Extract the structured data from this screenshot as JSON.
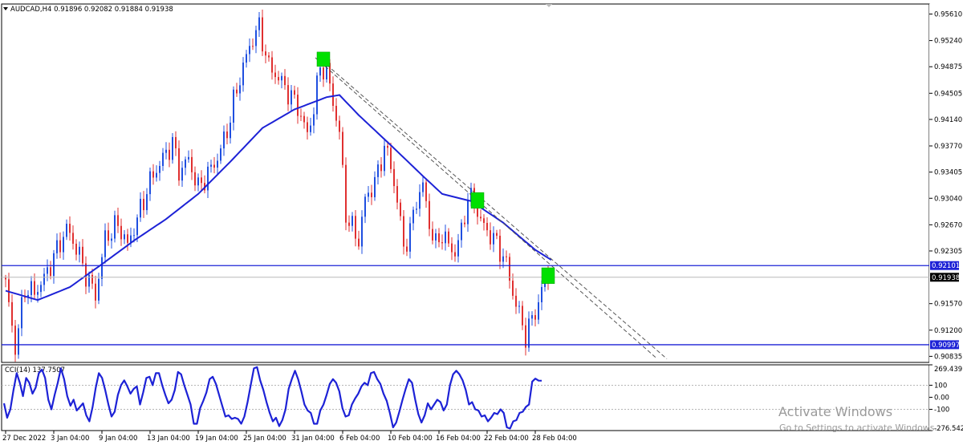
{
  "header": {
    "symbol_line": "AUDCAD,H4  0.91896 0.92082 0.91884 0.91938"
  },
  "watermark": {
    "title": "Activate Windows",
    "subtitle": "Go to Settings to activate Windows."
  },
  "colors": {
    "bull": "#1f4fe0",
    "bear": "#e03030",
    "ma": "#1d22d6",
    "hline": "#1d22d6",
    "box": "#00e000",
    "cci": "#1d22d6",
    "price_tag_bg": "#1d22d6",
    "current_tag_bg": "#000000"
  },
  "chart_data": [
    {
      "type": "candlestick",
      "title": "AUDCAD,H4",
      "ylim": [
        0.9075,
        0.9575
      ],
      "yticks": [
        "0.95610",
        "0.95240",
        "0.94875",
        "0.94505",
        "0.94140",
        "0.93770",
        "0.93405",
        "0.93040",
        "0.92670",
        "0.92305",
        "0.91570",
        "0.91200",
        "0.90835"
      ],
      "xticks": [
        "27 Dec 2022",
        "3 Jan 04:00",
        "9 Jan 04:00",
        "13 Jan 04:00",
        "19 Jan 04:00",
        "25 Jan 04:00",
        "31 Jan 04:00",
        "6 Feb 04:00",
        "10 Feb 04:00",
        "16 Feb 04:00",
        "22 Feb 04:00",
        "28 Feb 04:00"
      ],
      "close_anchors": [
        [
          0,
          0.9185
        ],
        [
          3,
          0.9095
        ],
        [
          6,
          0.9178
        ],
        [
          9,
          0.9172
        ],
        [
          12,
          0.9192
        ],
        [
          15,
          0.9222
        ],
        [
          19,
          0.9262
        ],
        [
          22,
          0.9235
        ],
        [
          25,
          0.9198
        ],
        [
          28,
          0.9168
        ],
        [
          31,
          0.9248
        ],
        [
          35,
          0.9268
        ],
        [
          38,
          0.9238
        ],
        [
          42,
          0.9288
        ],
        [
          45,
          0.9328
        ],
        [
          48,
          0.9352
        ],
        [
          52,
          0.9382
        ],
        [
          54,
          0.9342
        ],
        [
          57,
          0.9358
        ],
        [
          60,
          0.9318
        ],
        [
          63,
          0.9338
        ],
        [
          66,
          0.936
        ],
        [
          69,
          0.9398
        ],
        [
          71,
          0.9438
        ],
        [
          74,
          0.9488
        ],
        [
          77,
          0.9528
        ],
        [
          79,
          0.9542
        ],
        [
          82,
          0.9488
        ],
        [
          85,
          0.9472
        ],
        [
          88,
          0.9452
        ],
        [
          91,
          0.9432
        ],
        [
          94,
          0.9392
        ],
        [
          96,
          0.943
        ],
        [
          98,
          0.9488
        ],
        [
          100,
          0.9482
        ],
        [
          102,
          0.9438
        ],
        [
          104,
          0.9395
        ],
        [
          106,
          0.9282
        ],
        [
          108,
          0.9262
        ],
        [
          110,
          0.9245
        ],
        [
          112,
          0.9302
        ],
        [
          114,
          0.9318
        ],
        [
          116,
          0.9338
        ],
        [
          118,
          0.9378
        ],
        [
          120,
          0.9348
        ],
        [
          122,
          0.9302
        ],
        [
          124,
          0.9235
        ],
        [
          126,
          0.9258
        ],
        [
          128,
          0.9302
        ],
        [
          130,
          0.9322
        ],
        [
          132,
          0.9268
        ],
        [
          134,
          0.9238
        ],
        [
          136,
          0.9255
        ],
        [
          138,
          0.9238
        ],
        [
          140,
          0.9228
        ],
        [
          142,
          0.9258
        ],
        [
          144,
          0.9305
        ],
        [
          146,
          0.9298
        ],
        [
          148,
          0.9272
        ],
        [
          150,
          0.9258
        ],
        [
          152,
          0.9248
        ],
        [
          154,
          0.9232
        ],
        [
          156,
          0.9212
        ],
        [
          158,
          0.9172
        ],
        [
          160,
          0.9142
        ],
        [
          162,
          0.9112
        ],
        [
          164,
          0.9135
        ],
        [
          166,
          0.9158
        ],
        [
          168,
          0.9195
        ],
        [
          169,
          0.9194
        ]
      ],
      "series": [
        {
          "name": "",
          "indicator": "moving average",
          "anchors": [
            [
              0,
              0.9175
            ],
            [
              10,
              0.9162
            ],
            [
              20,
              0.918
            ],
            [
              30,
              0.9212
            ],
            [
              40,
              0.9245
            ],
            [
              50,
              0.9275
            ],
            [
              60,
              0.931
            ],
            [
              70,
              0.9355
            ],
            [
              80,
              0.9402
            ],
            [
              90,
              0.9428
            ],
            [
              100,
              0.9445
            ],
            [
              104,
              0.9448
            ],
            [
              110,
              0.942
            ],
            [
              120,
              0.9378
            ],
            [
              130,
              0.9335
            ],
            [
              136,
              0.931
            ],
            [
              145,
              0.93
            ],
            [
              155,
              0.927
            ],
            [
              165,
              0.9232
            ],
            [
              170,
              0.9218
            ]
          ]
        }
      ],
      "horizontal_lines": [
        {
          "value": 0.92101,
          "label": "0.92101"
        },
        {
          "value": 0.90997,
          "label": "0.90997"
        }
      ],
      "current_price": {
        "value": 0.91938,
        "label": "0.91938"
      },
      "trendlines": [
        {
          "from": [
            0.95,
            96.5
          ],
          "to": [
            0.908,
            203
          ]
        },
        {
          "from": [
            0.9496,
            98.5
          ],
          "to": [
            0.908,
            206
          ]
        }
      ],
      "highlight_boxes": [
        {
          "bar": 99,
          "low": 0.9488,
          "high": 0.9508
        },
        {
          "bar": 147,
          "low": 0.929,
          "high": 0.9312
        },
        {
          "bar": 169,
          "low": 0.9185,
          "high": 0.9207
        }
      ]
    },
    {
      "type": "line",
      "title": "CCI(14) 137.7507",
      "ylim": [
        -276.5425,
        269.439
      ],
      "yticks": [
        "269.439",
        "100",
        "0.00",
        "-100",
        "-276.5425"
      ],
      "reference_levels": [
        100,
        -100
      ],
      "series": [
        {
          "name": "CCI(14)",
          "anchors": [
            [
              0,
              -50
            ],
            [
              1,
              -170
            ],
            [
              2,
              -100
            ],
            [
              3,
              60
            ],
            [
              4,
              200
            ],
            [
              5,
              120
            ],
            [
              6,
              10
            ],
            [
              7,
              160
            ],
            [
              8,
              120
            ],
            [
              9,
              30
            ],
            [
              10,
              80
            ],
            [
              11,
              200
            ],
            [
              12,
              230
            ],
            [
              13,
              160
            ],
            [
              14,
              -20
            ],
            [
              15,
              -100
            ],
            [
              16,
              20
            ],
            [
              17,
              120
            ],
            [
              18,
              240
            ],
            [
              19,
              150
            ],
            [
              20,
              10
            ],
            [
              21,
              -70
            ],
            [
              22,
              -20
            ],
            [
              23,
              -110
            ],
            [
              24,
              -80
            ],
            [
              25,
              -50
            ],
            [
              26,
              -150
            ],
            [
              27,
              -200
            ],
            [
              28,
              -80
            ],
            [
              29,
              80
            ],
            [
              30,
              200
            ],
            [
              31,
              160
            ],
            [
              32,
              60
            ],
            [
              33,
              -60
            ],
            [
              34,
              -160
            ],
            [
              35,
              -120
            ],
            [
              36,
              20
            ],
            [
              37,
              100
            ],
            [
              38,
              140
            ],
            [
              39,
              90
            ],
            [
              40,
              30
            ],
            [
              41,
              70
            ],
            [
              42,
              90
            ],
            [
              43,
              -60
            ],
            [
              44,
              40
            ],
            [
              45,
              160
            ],
            [
              46,
              170
            ],
            [
              47,
              100
            ],
            [
              48,
              200
            ],
            [
              49,
              200
            ],
            [
              50,
              100
            ],
            [
              51,
              20
            ],
            [
              52,
              -50
            ],
            [
              53,
              -20
            ],
            [
              54,
              60
            ],
            [
              55,
              210
            ],
            [
              56,
              190
            ],
            [
              57,
              100
            ],
            [
              58,
              20
            ],
            [
              59,
              -60
            ],
            [
              60,
              -220
            ],
            [
              61,
              -220
            ],
            [
              62,
              -90
            ],
            [
              63,
              -30
            ],
            [
              64,
              40
            ],
            [
              65,
              150
            ],
            [
              66,
              170
            ],
            [
              67,
              110
            ],
            [
              68,
              20
            ],
            [
              69,
              -70
            ],
            [
              70,
              -160
            ],
            [
              71,
              -150
            ],
            [
              72,
              -180
            ],
            [
              73,
              -170
            ],
            [
              74,
              -180
            ],
            [
              75,
              -220
            ],
            [
              76,
              -160
            ],
            [
              77,
              -40
            ],
            [
              78,
              100
            ],
            [
              79,
              240
            ],
            [
              80,
              250
            ],
            [
              81,
              140
            ],
            [
              82,
              60
            ],
            [
              83,
              -40
            ],
            [
              84,
              -130
            ],
            [
              85,
              -200
            ],
            [
              86,
              -170
            ],
            [
              87,
              -240
            ],
            [
              88,
              -190
            ],
            [
              89,
              -100
            ],
            [
              90,
              70
            ],
            [
              91,
              150
            ],
            [
              92,
              220
            ],
            [
              93,
              150
            ],
            [
              94,
              50
            ],
            [
              95,
              -60
            ],
            [
              96,
              -110
            ],
            [
              97,
              -130
            ],
            [
              98,
              -220
            ],
            [
              99,
              -220
            ],
            [
              100,
              -110
            ],
            [
              101,
              -60
            ],
            [
              102,
              20
            ],
            [
              103,
              110
            ],
            [
              104,
              150
            ],
            [
              105,
              120
            ],
            [
              106,
              50
            ],
            [
              107,
              -90
            ],
            [
              108,
              -160
            ],
            [
              109,
              -150
            ],
            [
              110,
              -60
            ],
            [
              111,
              -10
            ],
            [
              112,
              30
            ],
            [
              113,
              90
            ],
            [
              114,
              120
            ],
            [
              115,
              100
            ],
            [
              116,
              200
            ],
            [
              117,
              210
            ],
            [
              118,
              150
            ],
            [
              119,
              110
            ],
            [
              120,
              30
            ],
            [
              121,
              -30
            ],
            [
              122,
              -130
            ],
            [
              123,
              -250
            ],
            [
              124,
              -210
            ],
            [
              125,
              -120
            ],
            [
              126,
              -20
            ],
            [
              127,
              70
            ],
            [
              128,
              150
            ],
            [
              129,
              120
            ],
            [
              130,
              -20
            ],
            [
              131,
              -140
            ],
            [
              132,
              -210
            ],
            [
              133,
              -150
            ],
            [
              134,
              -50
            ],
            [
              135,
              -100
            ],
            [
              136,
              -60
            ],
            [
              137,
              -20
            ],
            [
              138,
              -40
            ],
            [
              139,
              -110
            ],
            [
              140,
              -60
            ],
            [
              141,
              100
            ],
            [
              142,
              190
            ],
            [
              143,
              220
            ],
            [
              144,
              190
            ],
            [
              145,
              140
            ],
            [
              146,
              60
            ],
            [
              147,
              -60
            ],
            [
              148,
              -40
            ],
            [
              149,
              -100
            ],
            [
              150,
              -110
            ],
            [
              151,
              -160
            ],
            [
              152,
              -150
            ],
            [
              153,
              -200
            ],
            [
              154,
              -170
            ],
            [
              155,
              -130
            ],
            [
              156,
              -140
            ],
            [
              157,
              -100
            ],
            [
              158,
              -130
            ],
            [
              159,
              -250
            ],
            [
              160,
              -260
            ],
            [
              161,
              -200
            ],
            [
              162,
              -190
            ],
            [
              163,
              -130
            ],
            [
              164,
              -120
            ],
            [
              165,
              -80
            ],
            [
              166,
              -60
            ],
            [
              167,
              130
            ],
            [
              168,
              155
            ],
            [
              169,
              138
            ],
            [
              170,
              137.7507
            ]
          ]
        }
      ]
    }
  ]
}
